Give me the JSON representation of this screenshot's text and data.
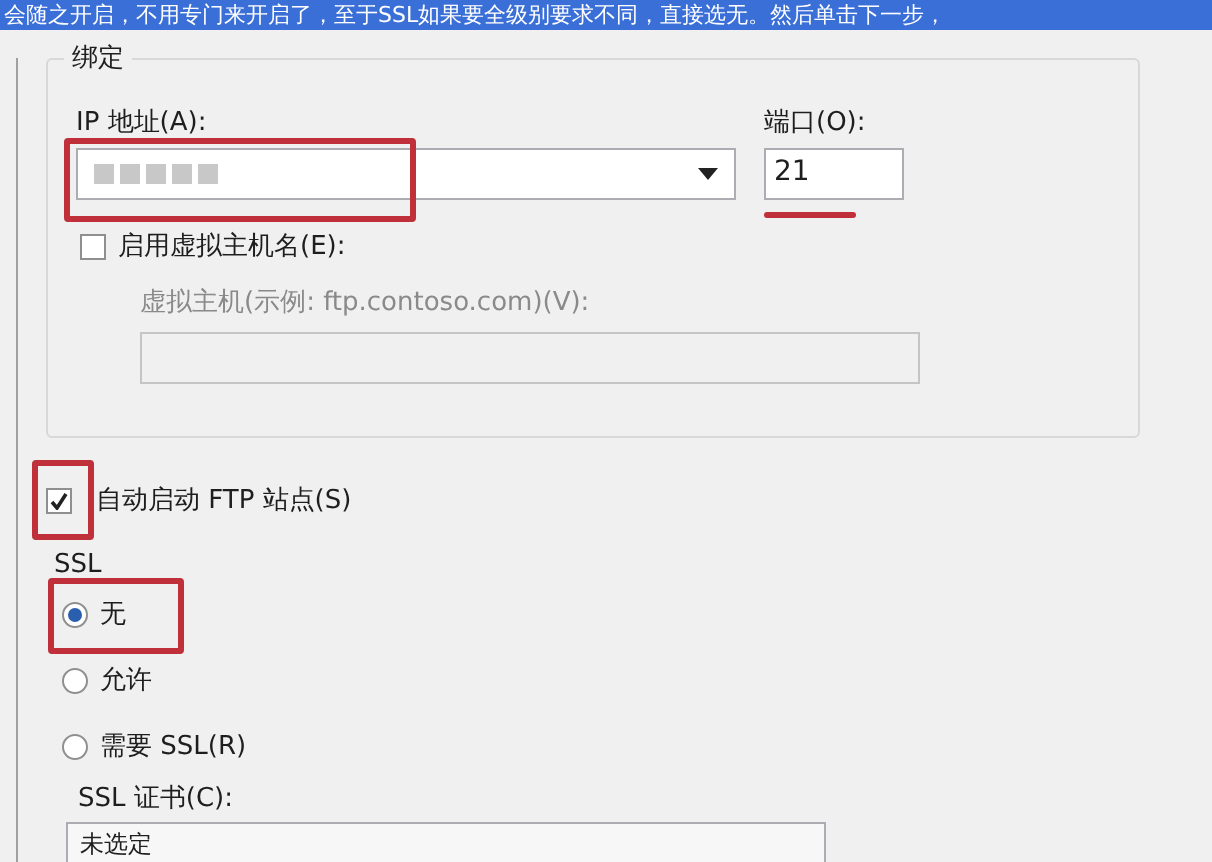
{
  "banner": {
    "text": "会随之开启，不用专门来开启了，至于SSL如果要全级别要求不同，直接选无。然后单击下一步，"
  },
  "binding": {
    "title": "绑定",
    "ip": {
      "label": "IP 地址(A):",
      "value_obscured": true,
      "highlighted": true
    },
    "port": {
      "label": "端口(O):",
      "value": "21",
      "underlined": true
    },
    "virtual_host": {
      "label": "启用虚拟主机名(E):",
      "checked": false
    },
    "host_example": {
      "label": "虚拟主机(示例: ftp.contoso.com)(V):",
      "disabled": true
    }
  },
  "auto_start": {
    "label": "自动启动 FTP 站点(S)",
    "checked": true,
    "highlighted": true
  },
  "ssl": {
    "title": "SSL",
    "options": [
      {
        "label": "无",
        "selected": true,
        "highlighted": true
      },
      {
        "label": "允许",
        "selected": false,
        "highlighted": false
      },
      {
        "label": "需要 SSL(R)",
        "selected": false,
        "highlighted": false
      }
    ],
    "certificate": {
      "label": "SSL 证书(C):",
      "value": "未选定"
    }
  }
}
